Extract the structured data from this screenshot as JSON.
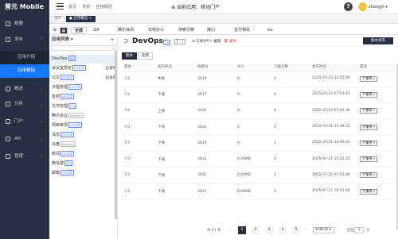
{
  "app": {
    "name": "普元 Mobile",
    "current_app": "当前应用：移动门户",
    "user": "zhangjh"
  },
  "breadcrumb": [
    "首页",
    "发布",
    "应用概括"
  ],
  "sidenav": {
    "items": [
      {
        "label": "概要",
        "icon": "grid-icon"
      },
      {
        "label": "发布",
        "icon": "send-icon"
      },
      {
        "label": "应用介绍"
      },
      {
        "label": "应用概括",
        "active": true
      },
      {
        "label": "概述",
        "icon": "chart-icon"
      },
      {
        "label": "分析",
        "icon": "analytics-icon"
      },
      {
        "label": "门户",
        "icon": "portal-icon"
      },
      {
        "label": "API",
        "icon": "api-icon"
      },
      {
        "label": "管理",
        "icon": "gear-icon"
      }
    ]
  },
  "tabbar": {
    "home": "首页",
    "active_tab": "应用概括"
  },
  "categories": [
    "全部",
    "OA",
    "娱乐休闲",
    "日常办公",
    "搜索引擎",
    "接口",
    "支付相关",
    "ios"
  ],
  "applist": {
    "title": "应用列表",
    "items": [
      {
        "name": "DevOps",
        "tag": "RN"
      },
      {
        "name": "会议室预定",
        "tag": "H5在线",
        "action": "已发布"
      },
      {
        "name": "公文",
        "tag": "H5在线",
        "action": "已发布"
      },
      {
        "name": "日程管理",
        "tag": "H5在线"
      },
      {
        "name": "签到",
        "tag": "H5在线"
      },
      {
        "name": "文件管理",
        "tag": "iOS"
      },
      {
        "name": "腾讯会议",
        "tag": "Android"
      },
      {
        "name": "预审审领",
        "tag": "H5在线"
      },
      {
        "name": "消息",
        "tag": "H5在线"
      },
      {
        "name": "云盘",
        "tag": "Android"
      },
      {
        "name": "新闻",
        "tag": "H5在线"
      },
      {
        "name": "微信建",
        "tag": "RN"
      },
      {
        "name": "邮箱",
        "tag": "H5在线"
      }
    ]
  },
  "detail": {
    "title": "DevOps",
    "tag": "RN",
    "tool_btn": "[ · ]",
    "links": [
      "订阅API",
      "编辑",
      "删除"
    ],
    "publish_btn": "版本发布",
    "subtabs": [
      "版本",
      "反馈"
    ],
    "columns": [
      "版本",
      "发布状态",
      "构建号",
      "大小",
      "下载次数",
      "发布时间",
      "操作"
    ],
    "rows": [
      {
        "version": "7.0",
        "status": "失败",
        "build": "3019",
        "size": "0",
        "downloads": "0",
        "time": "2025-07-23 13:55:06",
        "op": "计量看"
      },
      {
        "version": "7.0",
        "status": "下线",
        "build": "3017",
        "size": "0",
        "downloads": "0",
        "time": "2025-07-23 07:03:15",
        "op": "计量看"
      },
      {
        "version": "7.0",
        "status": "上线",
        "build": "3016",
        "size": "0",
        "downloads": "0",
        "time": "2025-07-23 07:03:36",
        "op": "计量看"
      },
      {
        "version": "7.0",
        "status": "下线",
        "build": "3015",
        "size": "0",
        "downloads": "0",
        "time": "2025-07-21 15:49:22",
        "op": "计量看"
      },
      {
        "version": "7.0",
        "status": "下线",
        "build": "3014",
        "size": "0",
        "downloads": "1",
        "time": "2025-07-21 14:49:01",
        "op": "计量看"
      },
      {
        "version": "7.0",
        "status": "下线",
        "build": "3013",
        "size": "0.00MB",
        "downloads": "0",
        "time": "2025-07-21 15:25:22",
        "op": "计量看"
      },
      {
        "version": "7.0",
        "status": "下线",
        "build": "3012",
        "size": "0.00MB",
        "downloads": "1",
        "time": "2025-07-20 07:03:46",
        "op": "计量看"
      },
      {
        "version": "7.0",
        "status": "下线",
        "build": "3011",
        "size": "0.00MB",
        "downloads": "0",
        "time": "2025-07-17 15:41:16",
        "op": "计量看"
      }
    ]
  },
  "pagination": {
    "total": "共 41 条",
    "pages": [
      "1",
      "2",
      "3",
      "4",
      "5"
    ],
    "page_size": "10条/页",
    "goto_label": "前往",
    "goto_value": "1",
    "page_suffix": "页"
  }
}
